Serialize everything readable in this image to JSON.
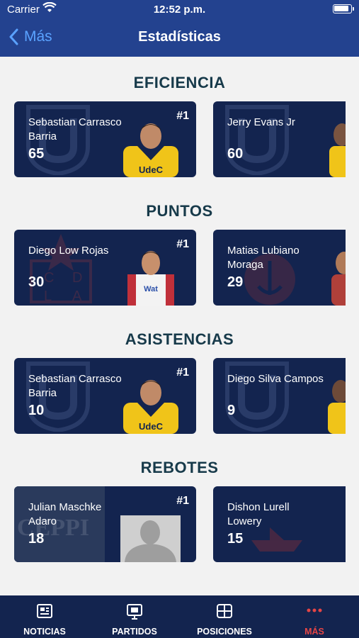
{
  "status": {
    "carrier": "Carrier",
    "time": "12:52 p.m."
  },
  "nav": {
    "back_label": "Más",
    "title": "Estadísticas"
  },
  "sections": [
    {
      "title": "EFICIENCIA",
      "cards": [
        {
          "rank": "#1",
          "name": "Sebastian Carrasco Barria",
          "value": "65"
        },
        {
          "name": "Jerry Evans Jr",
          "value": "60"
        }
      ]
    },
    {
      "title": "PUNTOS",
      "cards": [
        {
          "rank": "#1",
          "name": "Diego Low Rojas",
          "value": "30"
        },
        {
          "name": "Matias Lubiano Moraga",
          "value": "29"
        }
      ]
    },
    {
      "title": "ASISTENCIAS",
      "cards": [
        {
          "rank": "#1",
          "name": "Sebastian Carrasco Barria",
          "value": "10"
        },
        {
          "name": "Diego Silva Campos",
          "value": "9"
        }
      ]
    },
    {
      "title": "REBOTES",
      "cards": [
        {
          "rank": "#1",
          "name": "Julian Maschke Adaro",
          "value": "18"
        },
        {
          "name": "Dishon Lurell Lowery",
          "value": "15"
        }
      ]
    }
  ],
  "tabs": [
    {
      "label": "NOTICIAS",
      "icon": "news-icon"
    },
    {
      "label": "PARTIDOS",
      "icon": "games-icon"
    },
    {
      "label": "POSICIONES",
      "icon": "standings-icon"
    },
    {
      "label": "MÁS",
      "icon": "more-icon",
      "active": true
    }
  ],
  "colors": {
    "bar": "#23428f",
    "card": "#13244f",
    "accent": "#e54545",
    "link": "#5aa2ff",
    "jersey_yellow": "#f0c419"
  },
  "logos": {
    "sponsor": "CEPPI",
    "jersey": "UdeC",
    "jersey_2": "Wat"
  }
}
